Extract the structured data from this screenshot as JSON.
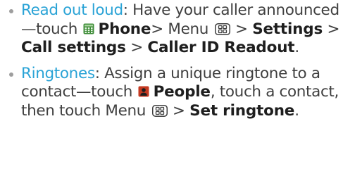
{
  "bullets": [
    {
      "term": "Read out loud",
      "sep": ":",
      "text1": " Have your caller announced—touch ",
      "icon": "phone-app-icon",
      "app": "Phone",
      "text2": "> Menu ",
      "text3": " > ",
      "settings": "Settings",
      "gt1": " > ",
      "call_settings": "Call settings",
      "gt2": " > ",
      "caller_id": "Caller ID Readout",
      "end": "."
    },
    {
      "term": "Ringtones",
      "sep": ":",
      "text1": " Assign a unique ringtone to a contact—touch ",
      "icon": "people-app-icon",
      "app": "People",
      "text2": ", touch a contact, then touch Menu ",
      "text3": " > ",
      "set_ringtone": "Set ringtone",
      "end": "."
    }
  ],
  "colors": {
    "term": "#2aa3d6",
    "bold": "#1e1e1e",
    "body": "#3f3f3f",
    "phone_icon": "#3f8d3a",
    "people_icon": "#c53a22"
  },
  "icons": {
    "menu_key": "menu-key-icon",
    "bullet": "bullet-dot-icon"
  }
}
